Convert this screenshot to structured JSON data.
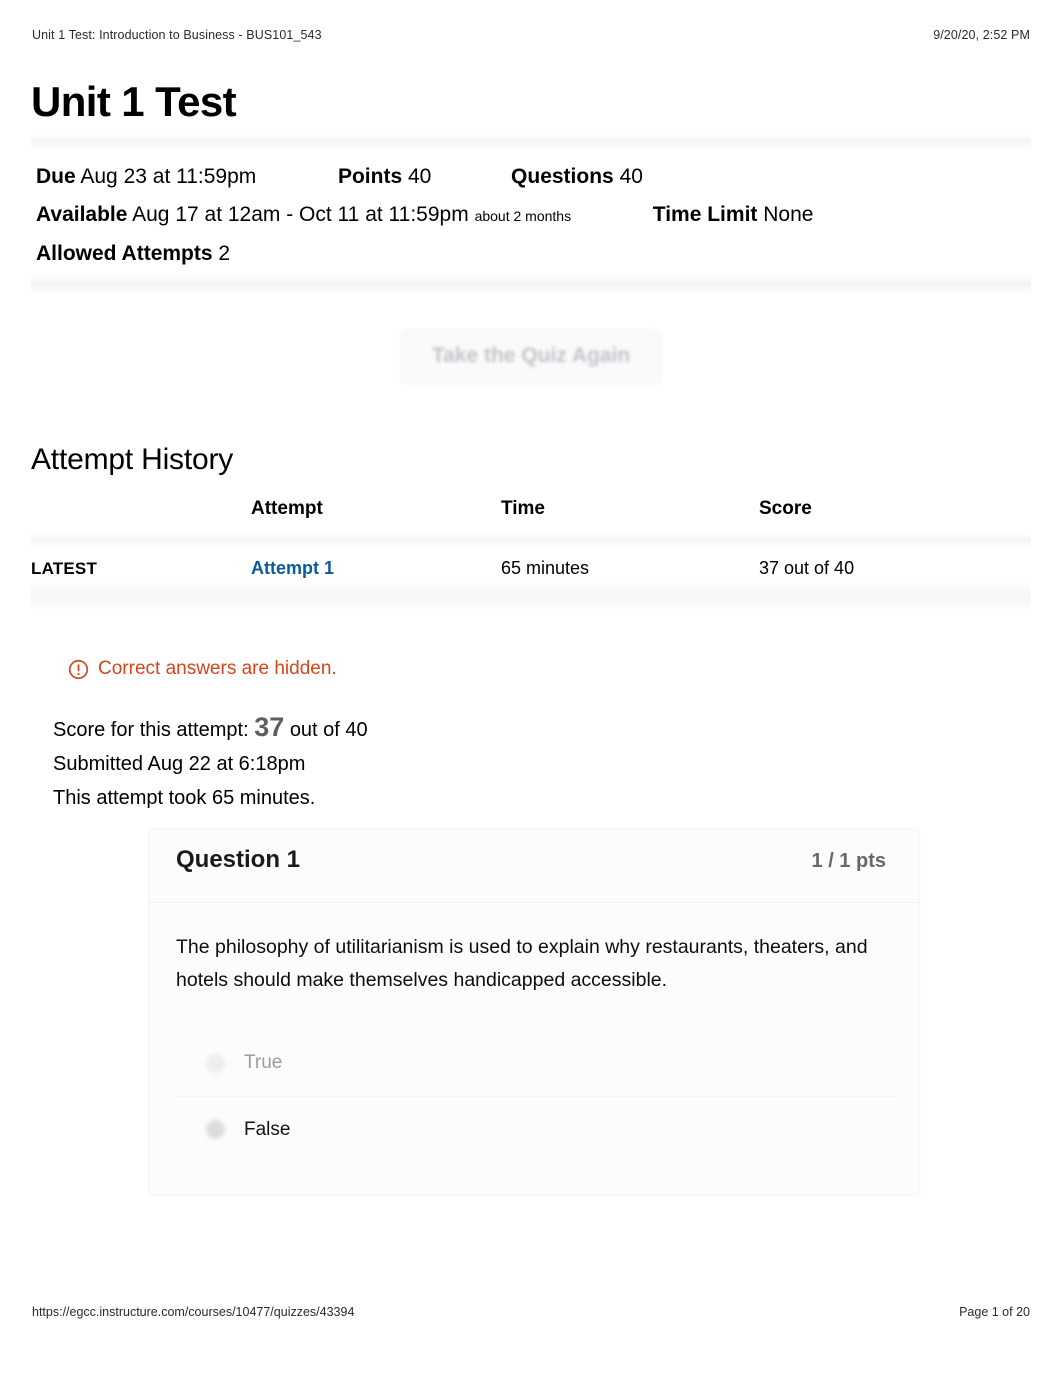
{
  "print_header": {
    "doc_title": "Unit 1 Test: Introduction to Business - BUS101_543",
    "timestamp": "9/20/20, 2:52 PM"
  },
  "print_footer": {
    "url": "https://egcc.instructure.com/courses/10477/quizzes/43394",
    "page_label": "Page 1 of 20"
  },
  "page": {
    "title": "Unit 1 Test"
  },
  "quiz_meta": {
    "due_label": "Due",
    "due_value": "Aug 23 at 11:59pm",
    "points_label": "Points",
    "points_value": "40",
    "questions_label": "Questions",
    "questions_value": "40",
    "available_label": "Available",
    "available_value": "Aug 17 at 12am - Oct 11 at 11:59pm",
    "available_note": "about 2 months",
    "time_limit_label": "Time Limit",
    "time_limit_value": "None",
    "allowed_attempts_label": "Allowed Attempts",
    "allowed_attempts_value": "2"
  },
  "actions": {
    "retake_label": "Take the Quiz Again"
  },
  "attempt_history": {
    "heading": "Attempt History",
    "columns": [
      "",
      "Attempt",
      "Time",
      "Score"
    ],
    "rows": [
      {
        "latest": "LATEST",
        "attempt": "Attempt 1",
        "time": "65 minutes",
        "score": "37 out of 40"
      }
    ]
  },
  "warning": {
    "icon": "exclamation-circle-icon",
    "text": "Correct answers are hidden.",
    "color": "#d4451c"
  },
  "attempt_summary": {
    "score_prefix": "Score for this attempt:",
    "score_value": "37",
    "score_suffix": "out of 40",
    "submitted": "Submitted Aug 22 at 6:18pm",
    "duration": "This attempt took 65 minutes."
  },
  "question": {
    "name": "Question 1",
    "points": "1 / 1 pts",
    "text": "The philosophy of utilitarianism is used to explain why restaurants, theaters, and hotels should make themselves handicapped accessible.",
    "answers": [
      {
        "label": "True",
        "selected": false
      },
      {
        "label": "False",
        "selected": true
      }
    ]
  },
  "colors": {
    "link": "#0a5a9e",
    "warning": "#d4451c",
    "score_grey": "#5b5f63"
  }
}
